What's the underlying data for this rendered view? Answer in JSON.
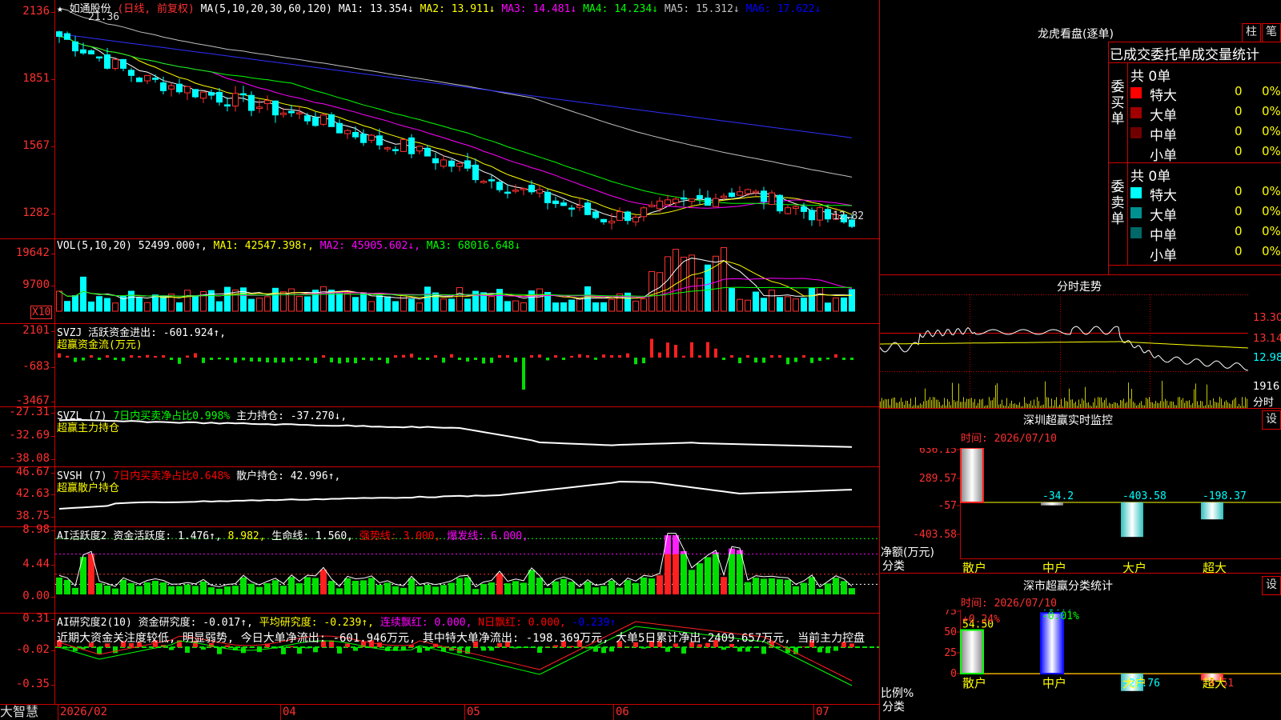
{
  "stock": {
    "name": "如通股份",
    "period": "(日线, 前复权)"
  },
  "price_panel": {
    "ma_label": "MA(5,10,20,30,60,120)",
    "ma_items": [
      {
        "text": "MA1: 13.354↓",
        "color": "#ffffff"
      },
      {
        "text": "MA2: 13.911↓",
        "color": "#ffff00"
      },
      {
        "text": "MA3: 14.481↓",
        "color": "#ff00ff"
      },
      {
        "text": "MA4: 14.234↓",
        "color": "#00ff00"
      },
      {
        "text": "MA5: 15.312↓",
        "color": "#c0c0c0"
      },
      {
        "text": "MA6: 17.622↓",
        "color": "#0000ff"
      }
    ],
    "axis": [
      "2136",
      "1851",
      "1567",
      "1282"
    ],
    "high_label": "21.36",
    "low_label": "12.82"
  },
  "vol_panel": {
    "title": "VOL(5,10,20)",
    "items": [
      {
        "text": "52499.000↑,",
        "color": "#ffffff"
      },
      {
        "text": "MA1: 42547.398↑,",
        "color": "#ffff00"
      },
      {
        "text": "MA2: 45905.602↓,",
        "color": "#ff00ff"
      },
      {
        "text": "MA3: 68016.648↓",
        "color": "#00ff00"
      }
    ],
    "axis": [
      "19642",
      "9700"
    ],
    "unit": "X10"
  },
  "svzj_panel": {
    "line1": [
      {
        "text": "SVZJ 活跃资金进出: -601.924↑,",
        "color": "#ffffff"
      }
    ],
    "line2": "超赢资金流(万元)",
    "axis": [
      "2101",
      "-683",
      "-3467"
    ]
  },
  "svzl_panel": {
    "line1": [
      {
        "text": "SVZL (7)",
        "color": "#ffffff"
      },
      {
        "text": "7日内买卖净占比0.998%",
        "color": "#00ff00"
      },
      {
        "text": "主力持仓: -37.270↓,",
        "color": "#ffffff"
      }
    ],
    "line2": "超赢主力持仓",
    "axis": [
      "-27.31",
      "-32.69",
      "-38.08"
    ]
  },
  "svsh_panel": {
    "line1": [
      {
        "text": "SVSH (7)",
        "color": "#ffffff"
      },
      {
        "text": "7日内买卖净占比0.648%",
        "color": "#ff0000"
      },
      {
        "text": "散户持仓: 42.996↑,",
        "color": "#ffffff"
      }
    ],
    "line2": "超赢散户持仓",
    "axis": [
      "46.67",
      "42.63",
      "38.75"
    ]
  },
  "ai_panel": {
    "line1": [
      {
        "text": "AI活跃度2",
        "color": "#ffffff"
      },
      {
        "text": "资金活跃度: 1.476↑,",
        "color": "#ffffff"
      },
      {
        "text": "8.982,",
        "color": "#ffff00"
      },
      {
        "text": "生命线: 1.560,",
        "color": "#ffffff"
      },
      {
        "text": "强势线: 3.000,",
        "color": "#ff0000"
      },
      {
        "text": "爆发线: 6.000,",
        "color": "#ff00ff"
      }
    ],
    "axis": [
      "8.98",
      "4.44",
      "0.00"
    ]
  },
  "research_panel": {
    "line1": [
      {
        "text": "AI研究度2(10)",
        "color": "#ffffff"
      },
      {
        "text": "资金研究度: -0.017↑,",
        "color": "#ffffff"
      },
      {
        "text": "平均研究度: -0.239↑,",
        "color": "#ffff00"
      },
      {
        "text": "连续飘红: 0.000,",
        "color": "#ff00ff"
      },
      {
        "text": "N日飘红: 0.000,",
        "color": "#ff0000"
      },
      {
        "text": "-0.239↑",
        "color": "#0000ff"
      }
    ],
    "line2": "近期大资金关注度较低, 明显弱势, 今日大单净流出: -601.946万元, 其中特大单净流出: -198.369万元, 大单5日累计净出-2409.657万元, 当前主力控盘",
    "axis": [
      "0.31",
      "-0.02",
      "-0.35"
    ]
  },
  "date_axis": [
    "2026/02",
    "04",
    "05",
    "06",
    "07"
  ],
  "brand": "大智慧",
  "dragon": {
    "title": "龙虎看盘(逐单)",
    "btn1": "柱",
    "btn2": "笔",
    "header": "已成交委托单成交量统计",
    "buy": {
      "label": "委买单",
      "total": "共 0单",
      "rows": [
        {
          "name": "特大",
          "val": "0",
          "pct": "0%",
          "color": "#ff0000"
        },
        {
          "name": "大单",
          "val": "0",
          "pct": "0%",
          "color": "#a00000"
        },
        {
          "name": "中单",
          "val": "0",
          "pct": "0%",
          "color": "#700000"
        },
        {
          "name": "小单",
          "val": "0",
          "pct": "0%",
          "color": ""
        }
      ]
    },
    "sell": {
      "label": "委卖单",
      "total": "共 0单",
      "rows": [
        {
          "name": "特大",
          "val": "0",
          "pct": "0%",
          "color": "#00ffff"
        },
        {
          "name": "大单",
          "val": "0",
          "pct": "0%",
          "color": "#009090"
        },
        {
          "name": "中单",
          "val": "0",
          "pct": "0%",
          "color": "#006868"
        },
        {
          "name": "小单",
          "val": "0",
          "pct": "0%",
          "color": ""
        }
      ]
    }
  },
  "fenshi": {
    "title": "分时走势",
    "axis": [
      "13.30",
      "13.14",
      "12.98"
    ],
    "vol": "1916",
    "vol_label": "分时"
  },
  "realtime": {
    "title": "深圳超赢实时监控",
    "btn": "设",
    "time": "时间: 2026/07/10",
    "axis": [
      "636.15",
      "289.57",
      "-57",
      "-403.58"
    ],
    "ylabel": "净额(万元)",
    "xlabel": "分类",
    "categories": [
      "散户",
      "中户",
      "大户",
      "超大"
    ],
    "values": [
      636.15,
      -34.2,
      -403.58,
      -198.37
    ],
    "value_labels": [
      "636.15",
      "-34.2",
      "-403.58",
      "-198.37"
    ],
    "value_colors": [
      "#ff3030",
      "#00ffff",
      "#00ffff",
      "#00ffff"
    ]
  },
  "classify": {
    "title": "深市超赢分类统计",
    "btn": "设",
    "time": "时间: 2026/07/10",
    "axis": [
      "75",
      "50",
      "25",
      "0"
    ],
    "top_labels": [
      "+0.24%",
      "-0.01%"
    ],
    "top_colors": [
      "#ff3030",
      "#00ff00"
    ],
    "ylabel": "比例%",
    "xlabel": "分类",
    "categories": [
      "散户",
      "中户",
      "大户",
      "超大"
    ],
    "values": [
      54.5,
      75.77,
      -21.76,
      -8.51
    ],
    "value_labels": [
      "54.50",
      "75.77",
      "-21.76",
      "-8.51"
    ],
    "value_colors": [
      "#ffff00",
      "#00ffff",
      "#00ffff",
      "#ff3030"
    ]
  },
  "colors": {
    "up": "#ff3030",
    "down": "#00ffff",
    "frame": "#cc0000",
    "axis_text": "#ff3030",
    "label_yellow": "#ffff00"
  }
}
